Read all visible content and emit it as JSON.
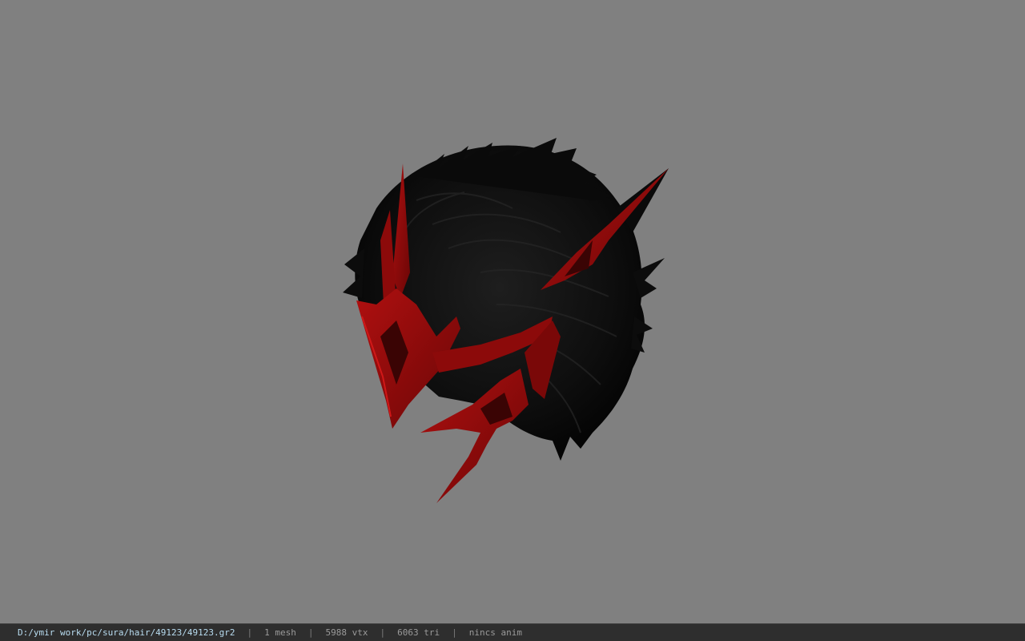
{
  "viewport": {
    "background_color": "#808080",
    "model": {
      "subject": "hair mesh with red horned crown",
      "hair_color": "#0b0b0b",
      "crown_color": "#8c0a0a",
      "crown_dark_color": "#3a0404"
    }
  },
  "statusbar": {
    "file_path": "D:/ymir work/pc/sura/hair/49123/49123.gr2",
    "mesh_count": "1 mesh",
    "vertex_count": "5988 vtx",
    "triangle_count": "6063 tri",
    "anim_status": "nincs anim",
    "separator": "|",
    "path_color": "#b8dcf0",
    "text_color": "#9a9a9a",
    "background_color": "#2e2e2e"
  }
}
